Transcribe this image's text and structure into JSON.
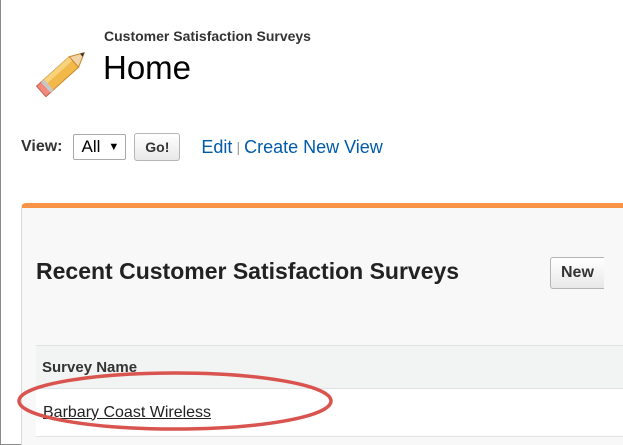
{
  "header": {
    "subtitle": "Customer Satisfaction Surveys",
    "title": "Home",
    "icon": "pencil-icon"
  },
  "view": {
    "label": "View:",
    "selected": "All",
    "go_label": "Go!",
    "edit_label": "Edit",
    "separator": "|",
    "create_label": "Create New View"
  },
  "recent": {
    "title": "Recent Customer Satisfaction Surveys",
    "new_label": "New",
    "columns": [
      "Survey Name"
    ],
    "rows": [
      {
        "name": "Barbary Coast Wireless"
      }
    ]
  },
  "colors": {
    "accent": "#f79448",
    "link": "#015ba7",
    "highlight": "#d9534f"
  }
}
